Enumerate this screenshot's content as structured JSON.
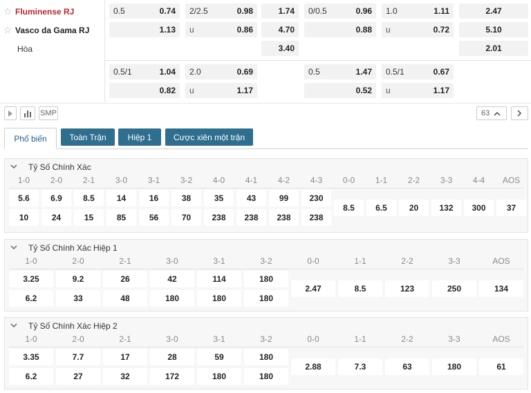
{
  "teams": {
    "home": "Fluminense RJ",
    "away": "Vasco da Gama RJ",
    "draw": "Hòa"
  },
  "odds_row1": {
    "ah1": {
      "home_hc": "0.5",
      "home_odd": "0.74",
      "away_odd": "1.13"
    },
    "ou1": {
      "line": "2/2.5",
      "over_odd": "0.98",
      "under_label": "u",
      "under_odd": "0.86"
    },
    "x12_1": {
      "home": "1.74",
      "away": "4.70",
      "draw": "3.40"
    },
    "ah2": {
      "home_hc": "0/0.5",
      "home_odd": "0.96",
      "away_odd": "0.88"
    },
    "ou2": {
      "line": "1.0",
      "over_odd": "1.11",
      "under_label": "u",
      "under_odd": "0.72"
    },
    "x12_2": {
      "home": "2.47",
      "away": "5.10",
      "draw": "2.01"
    }
  },
  "odds_row2": {
    "ah1": {
      "home_hc": "0.5/1",
      "home_odd": "1.04",
      "away_odd": "0.82"
    },
    "ou1": {
      "line": "2.0",
      "over_odd": "0.69",
      "under_label": "u",
      "under_odd": "1.17"
    },
    "ah2": {
      "home_hc": "0.5",
      "home_odd": "1.47",
      "away_odd": "0.52"
    },
    "ou2": {
      "line": "0.5/1",
      "over_odd": "0.67",
      "under_label": "u",
      "under_odd": "1.17"
    }
  },
  "toolbar": {
    "play_icon": "play-icon",
    "stats_icon": "bar-chart-icon",
    "smp_label": "SMP",
    "more_count": "63",
    "colors": {
      "accent": "#2e6e8f",
      "home_team": "#b3282d"
    }
  },
  "tabs": [
    {
      "label": "Phổ biến",
      "active": true
    },
    {
      "label": "Toàn Trận",
      "active": false
    },
    {
      "label": "Hiệp 1",
      "active": false
    },
    {
      "label": "Cược xiên một trận",
      "active": false
    }
  ],
  "panel_full": {
    "title": "Tỷ Số Chính Xác",
    "home_scores": [
      "1-0",
      "2-0",
      "2-1",
      "3-0",
      "3-1",
      "3-2",
      "4-0",
      "4-1",
      "4-2",
      "4-3"
    ],
    "home_odds": [
      "5.6",
      "6.9",
      "8.5",
      "14",
      "16",
      "38",
      "35",
      "43",
      "99",
      "230"
    ],
    "away_odds": [
      "10",
      "24",
      "15",
      "85",
      "56",
      "70",
      "238",
      "238",
      "238",
      "238"
    ],
    "draw_scores": [
      "0-0",
      "1-1",
      "2-2",
      "3-3",
      "4-4",
      "AOS"
    ],
    "draw_odds": [
      "8.5",
      "6.5",
      "20",
      "132",
      "300",
      "37"
    ]
  },
  "panel_h1": {
    "title": "Tỷ Số Chính Xác Hiệp 1",
    "home_scores": [
      "1-0",
      "2-0",
      "2-1",
      "3-0",
      "3-1",
      "3-2"
    ],
    "home_odds": [
      "3.25",
      "9.2",
      "26",
      "42",
      "114",
      "180"
    ],
    "away_odds": [
      "6.2",
      "33",
      "48",
      "180",
      "180",
      "180"
    ],
    "draw_scores": [
      "0-0",
      "1-1",
      "2-2",
      "3-3",
      "AOS"
    ],
    "draw_odds": [
      "2.47",
      "8.5",
      "123",
      "250",
      "134"
    ]
  },
  "panel_h2": {
    "title": "Tỷ Số Chính Xác Hiệp 2",
    "home_scores": [
      "1-0",
      "2-0",
      "2-1",
      "3-0",
      "3-1",
      "3-2"
    ],
    "home_odds": [
      "3.35",
      "7.7",
      "17",
      "28",
      "59",
      "180"
    ],
    "away_odds": [
      "6.2",
      "27",
      "32",
      "172",
      "180",
      "180"
    ],
    "draw_scores": [
      "0-0",
      "1-1",
      "2-2",
      "3-3",
      "AOS"
    ],
    "draw_odds": [
      "2.88",
      "7.3",
      "63",
      "180",
      "61"
    ]
  }
}
